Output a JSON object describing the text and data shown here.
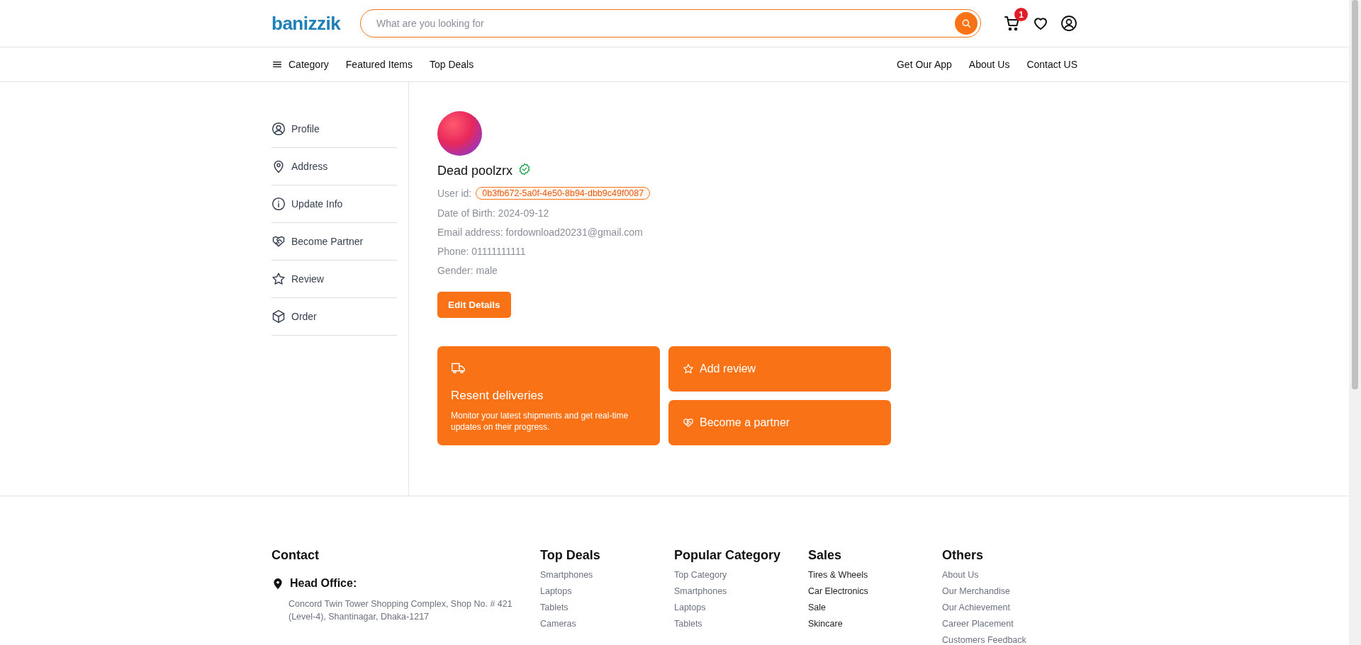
{
  "header": {
    "logo": "banizzik",
    "search": {
      "placeholder": "What are you looking for"
    },
    "cart_count": "1"
  },
  "nav": {
    "left": [
      {
        "label": "Category"
      },
      {
        "label": "Featured Items"
      },
      {
        "label": "Top Deals"
      }
    ],
    "right": [
      {
        "label": "Get Our App"
      },
      {
        "label": "About Us"
      },
      {
        "label": "Contact US"
      }
    ]
  },
  "sidebar": {
    "items": [
      {
        "label": "Profile"
      },
      {
        "label": "Address"
      },
      {
        "label": "Update Info"
      },
      {
        "label": "Become Partner"
      },
      {
        "label": "Review"
      },
      {
        "label": "Order"
      }
    ]
  },
  "profile": {
    "name": "Dead poolzrx",
    "verified": true,
    "user_id_label": "User id:",
    "user_id": "0b3fb672-5a0f-4e50-8b94-dbb9c49f0087",
    "fields": [
      "Date of Birth: 2024-09-12",
      "Email address: fordownload20231@gmail.com",
      "Phone: 01111111111",
      "Gender: male"
    ],
    "edit_button": "Edit Details"
  },
  "cards": {
    "deliveries": {
      "title": "Resent deliveries",
      "description": "Monitor your latest shipments and get real-time updates on their progress."
    },
    "actions": [
      {
        "label": "Add review"
      },
      {
        "label": "Become a partner"
      }
    ]
  },
  "footer": {
    "contact": {
      "title": "Contact",
      "office_label": "Head Office:",
      "address": "Concord Twin Tower Shopping Complex, Shop No. # 421 (Level-4), Shantinagar, Dhaka-1217"
    },
    "columns": [
      {
        "title": "Top Deals",
        "links": [
          "Smartphones",
          "Laptops",
          "Tablets",
          "Cameras"
        ]
      },
      {
        "title": "Popular Category",
        "links": [
          "Top Category",
          "Smartphones",
          "Laptops",
          "Tablets"
        ]
      },
      {
        "title": "Sales",
        "links": [
          "Tires & Wheels",
          "Car Electronics",
          "Sale",
          "Skincare"
        ]
      },
      {
        "title": "Others",
        "links": [
          "About Us",
          "Our Merchandise",
          "Our Achievement",
          "Career Placement",
          "Customers Feedback"
        ]
      }
    ]
  }
}
